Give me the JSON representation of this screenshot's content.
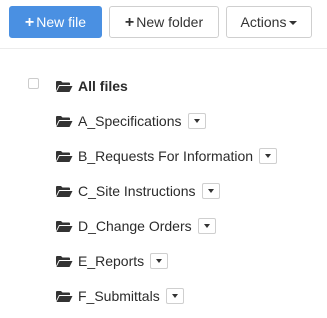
{
  "toolbar": {
    "new_file_label": "New file",
    "new_folder_label": "New folder",
    "actions_label": "Actions",
    "primary_color": "#4a90e2"
  },
  "tree": {
    "root_label": "All files",
    "folders": [
      "A_Specifications",
      "B_Requests For Information",
      "C_Site Instructions",
      "D_Change Orders",
      "E_Reports",
      "F_Submittals"
    ]
  }
}
